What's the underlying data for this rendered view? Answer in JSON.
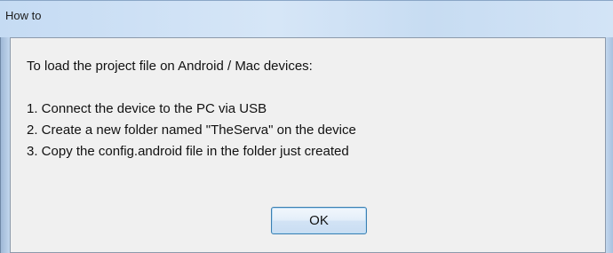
{
  "window": {
    "title": "How to"
  },
  "message": {
    "intro": "To load the project file on Android / Mac devices:",
    "steps": [
      "1. Connect the device to the PC via USB",
      "2. Create a new folder named \"TheServa\" on the device",
      "3. Copy the config.android file in the folder just created"
    ]
  },
  "buttons": {
    "ok_label": "OK"
  },
  "colors": {
    "titlebar": "#c9dcf1",
    "client_background": "#f0f0f0",
    "button_border": "#3c7fb1"
  }
}
